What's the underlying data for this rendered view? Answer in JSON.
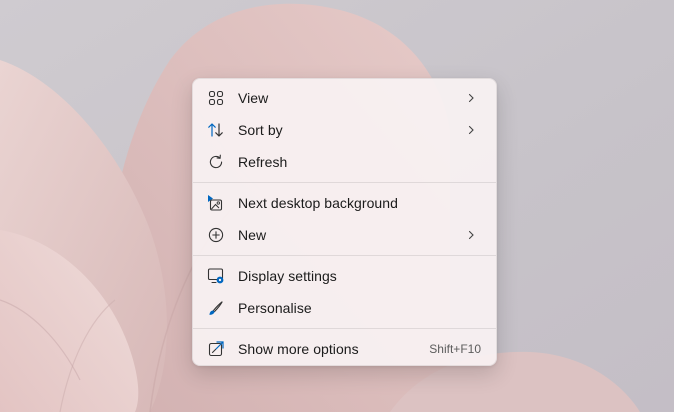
{
  "context_menu": {
    "items": [
      {
        "label": "View",
        "icon": "grid-view-icon",
        "has_submenu": true
      },
      {
        "label": "Sort by",
        "icon": "sort-arrows-icon",
        "has_submenu": true
      },
      {
        "label": "Refresh",
        "icon": "refresh-icon",
        "has_submenu": false
      },
      {
        "label": "Next desktop background",
        "icon": "next-background-icon",
        "has_submenu": false
      },
      {
        "label": "New",
        "icon": "plus-circle-icon",
        "has_submenu": true
      },
      {
        "label": "Display settings",
        "icon": "display-settings-icon",
        "has_submenu": false
      },
      {
        "label": "Personalise",
        "icon": "brush-icon",
        "has_submenu": false
      },
      {
        "label": "Show more options",
        "icon": "show-more-icon",
        "shortcut": "Shift+F10",
        "has_submenu": false
      }
    ]
  },
  "colors": {
    "accent": "#0067c0",
    "menu_background": "#f8f2f3",
    "text": "#1b1b1b",
    "desktop_bloom": "#e2c6c4",
    "desktop_background": "#c9c5cb"
  }
}
